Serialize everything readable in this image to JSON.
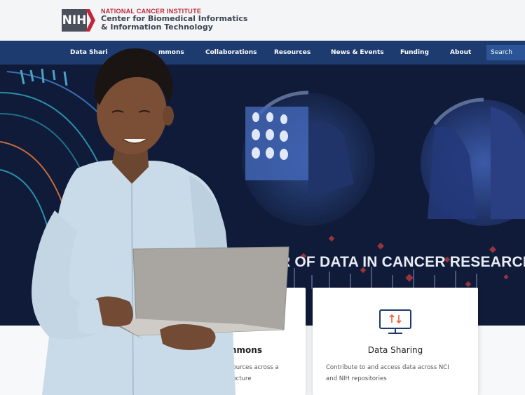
{
  "header": {
    "logo_text": "NIH",
    "org_line1": "NATIONAL CANCER INSTITUTE",
    "org_line2": "Center for Biomedical Informatics",
    "org_line3": "& Information Technology"
  },
  "nav": {
    "items": [
      {
        "label": "Data Shari"
      },
      {
        "label": "mmons"
      },
      {
        "label": "Collaborations"
      },
      {
        "label": "Resources"
      },
      {
        "label": "News & Events"
      },
      {
        "label": "Funding"
      },
      {
        "label": "About"
      }
    ],
    "search_label": "Search"
  },
  "hero": {
    "headline": "POWER OF DATA IN CANCER RESEARCH"
  },
  "cards": [
    {
      "title": "Commons",
      "desc_line1": "ny sources across a",
      "desc_line2": "structure"
    },
    {
      "title": "Data Sharing",
      "desc_line1": "Contribute to and access data across NCI",
      "desc_line2": "and NIH repositories",
      "icon": "monitor-arrows-icon"
    }
  ],
  "colors": {
    "nav_bg": "#1d3b6e",
    "brand_red": "#c0273a",
    "hero_bg": "#0f1a36",
    "search_bg": "#2b5597",
    "icon_accent": "#e8623a"
  }
}
